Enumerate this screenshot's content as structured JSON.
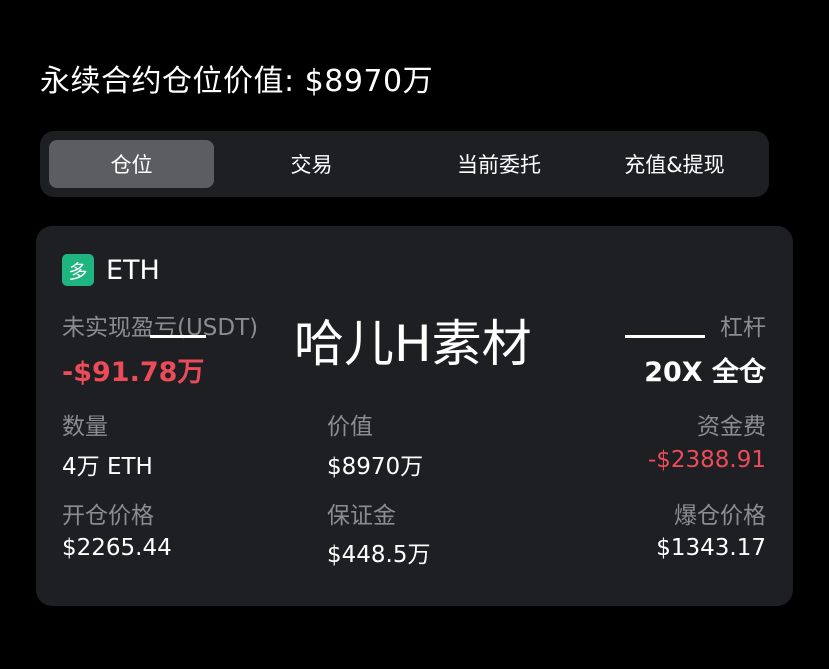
{
  "header": {
    "title": "永续合约仓位价值: $8970万"
  },
  "tabs": [
    {
      "label": "仓位",
      "active": true
    },
    {
      "label": "交易",
      "active": false
    },
    {
      "label": "当前委托",
      "active": false
    },
    {
      "label": "充值&提现",
      "active": false
    }
  ],
  "position": {
    "side_badge": "多",
    "symbol": "ETH",
    "unrealized_pnl_label": "未实现盈亏(USDT)",
    "unrealized_pnl_value": "-$91.78万",
    "leverage_label": "杠杆",
    "leverage_value": "20X 全仓",
    "quantity_label": "数量",
    "quantity_value": "4万 ETH",
    "value_label": "价值",
    "value_value": "$8970万",
    "funding_label": "资金费",
    "funding_value": "-$2388.91",
    "entry_price_label": "开仓价格",
    "entry_price_value": "$2265.44",
    "margin_label": "保证金",
    "margin_value": "$448.5万",
    "liquidation_price_label": "爆仓价格",
    "liquidation_price_value": "$1343.17"
  },
  "watermark": {
    "text": "哈儿H素材"
  },
  "colors": {
    "background": "#000000",
    "card": "#1e1f22",
    "tab_active": "#5b5d61",
    "long_badge": "#1fb580",
    "negative": "#ec4c59",
    "muted_label": "#8a8c91"
  }
}
